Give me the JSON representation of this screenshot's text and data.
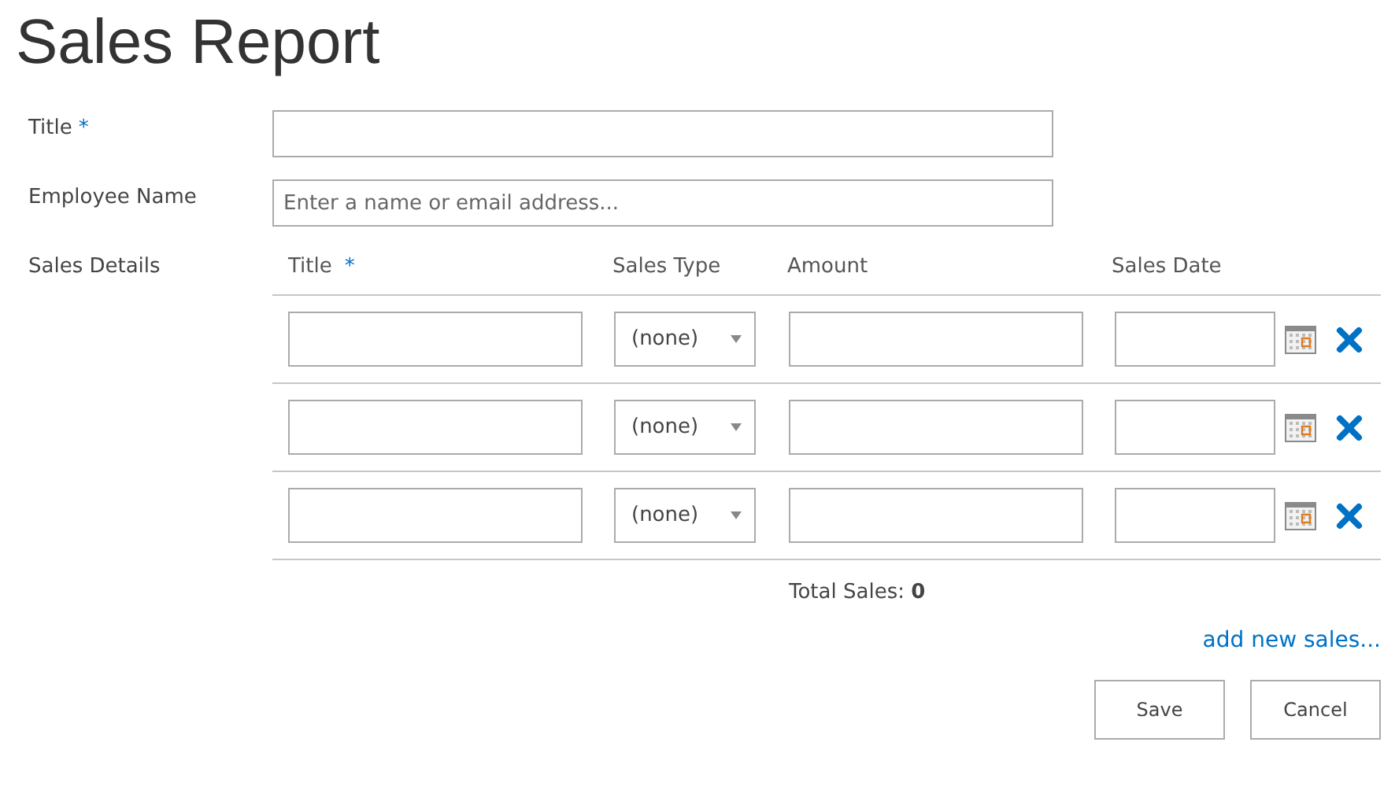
{
  "heading": "Sales Report",
  "fields": [
    {
      "label": "Title",
      "required_mark": "*"
    },
    {
      "label": "Employee Name",
      "placeholder": "Enter a name or email address..."
    }
  ],
  "sales_details": {
    "label": "Sales Details",
    "columns": [
      {
        "label": "Title",
        "required_mark": "*"
      },
      {
        "label": "Sales Type"
      },
      {
        "label": "Amount"
      },
      {
        "label": "Sales Date"
      }
    ],
    "rows": [
      {
        "sales_type": "(none)"
      },
      {
        "sales_type": "(none)"
      },
      {
        "sales_type": "(none)"
      }
    ],
    "total": "Total Sales: **0**",
    "add_link": "add new sales..."
  },
  "buttons": [
    "Save",
    "Cancel"
  ]
}
